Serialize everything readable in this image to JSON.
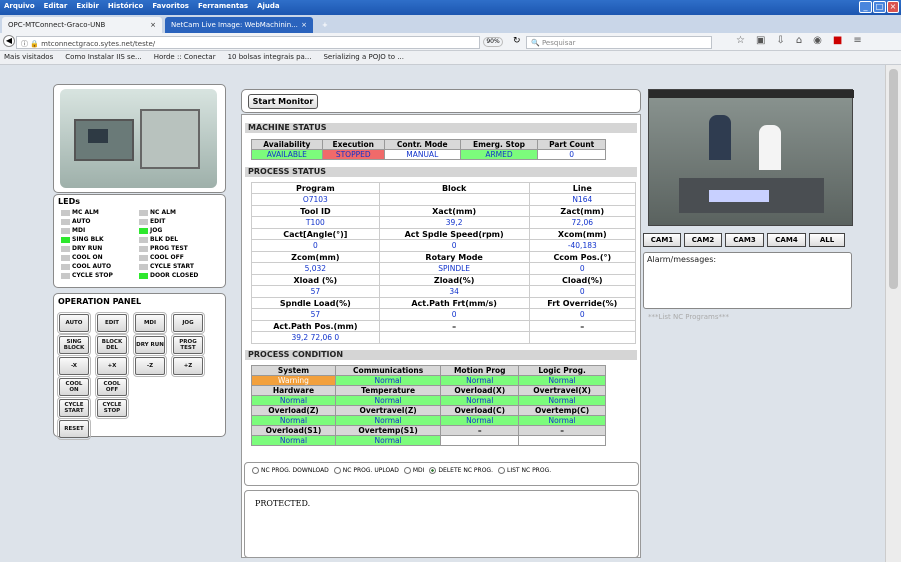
{
  "browser": {
    "menu": [
      "Arquivo",
      "Editar",
      "Exibir",
      "Histórico",
      "Favoritos",
      "Ferramentas",
      "Ajuda"
    ],
    "tabs": [
      "OPC-MTConnect-Graco-UNB",
      "NetCam Live Image: WebMachinin..."
    ],
    "new_tab": "+",
    "url": "mtconnectgraco.sytes.net/teste/",
    "zoom": "90%",
    "search_placeholder": "Pesquisar",
    "bookmarks": [
      "Mais visitados",
      "Como Instalar IIS se...",
      "Horde :: Conectar",
      "10 bolsas integrais pa...",
      "Serializing a POJO to ..."
    ]
  },
  "leds": {
    "title": "LEDs",
    "left": [
      {
        "label": "MC ALM",
        "on": false
      },
      {
        "label": "AUTO",
        "on": false
      },
      {
        "label": "MDI",
        "on": false
      },
      {
        "label": "SING BLK",
        "on": true
      },
      {
        "label": "DRY RUN",
        "on": false
      },
      {
        "label": "COOL ON",
        "on": false
      },
      {
        "label": "COOL AUTO",
        "on": false
      },
      {
        "label": "CYCLE STOP",
        "on": false
      }
    ],
    "right": [
      {
        "label": "NC ALM",
        "on": false
      },
      {
        "label": "EDIT",
        "on": false
      },
      {
        "label": "JOG",
        "on": true
      },
      {
        "label": "BLK DEL",
        "on": false
      },
      {
        "label": "PROG TEST",
        "on": false
      },
      {
        "label": "COOL OFF",
        "on": false
      },
      {
        "label": "CYCLE START",
        "on": false
      },
      {
        "label": "DOOR CLOSED",
        "on": true
      }
    ]
  },
  "operation_panel": {
    "title": "OPERATION PANEL",
    "buttons": [
      [
        "AUTO",
        "EDIT",
        "MDI",
        "JOG"
      ],
      [
        "SING BLOCK",
        "BLOCK DEL",
        "DRY RUN",
        "PROG TEST"
      ],
      [
        "-X",
        "+X",
        "-Z",
        "+Z"
      ],
      [
        "COOL ON",
        "COOL OFF"
      ],
      [
        "CYCLE START",
        "CYCLE STOP"
      ],
      [
        "RESET"
      ]
    ]
  },
  "start_monitor": "Start Monitor",
  "machine_status": {
    "title": "MACHINE STATUS",
    "headers": [
      "Availability",
      "Execution",
      "Contr. Mode",
      "Emerg. Stop",
      "Part Count"
    ],
    "values": [
      "AVAILABLE",
      "STOPPED",
      "MANUAL",
      "ARMED",
      "0"
    ]
  },
  "process_status": {
    "title": "PROCESS STATUS",
    "rows": [
      [
        "Program",
        "Block",
        "Line"
      ],
      [
        "O7103",
        "",
        "N164"
      ],
      [
        "Tool ID",
        "Xact(mm)",
        "Zact(mm)"
      ],
      [
        "T100",
        "39,2",
        "72,06"
      ],
      [
        "Cact[Angle(°)]",
        "Act Spdle Speed(rpm)",
        "Xcom(mm)"
      ],
      [
        "0",
        "0",
        "-40,183"
      ],
      [
        "Zcom(mm)",
        "Rotary Mode",
        "Ccom Pos.(°)"
      ],
      [
        "5,032",
        "SPINDLE",
        "0"
      ],
      [
        "Xload (%)",
        "Zload(%)",
        "Cload(%)"
      ],
      [
        "57",
        "34",
        "0"
      ],
      [
        "Spndle Load(%)",
        "Act.Path Frt(mm/s)",
        "Frt Override(%)"
      ],
      [
        "57",
        "0",
        "0"
      ],
      [
        "Act.Path Pos.(mm)",
        "–",
        "–"
      ],
      [
        "39,2 72,06 0",
        "",
        ""
      ]
    ]
  },
  "process_condition": {
    "title": "PROCESS CONDITION",
    "rows": [
      [
        "System",
        "Communications",
        "Motion Prog",
        "Logic Prog."
      ],
      [
        "Warning",
        "Normal",
        "Normal",
        "Normal"
      ],
      [
        "Hardware",
        "Temperature",
        "Overload(X)",
        "Overtravel(X)"
      ],
      [
        "Normal",
        "Normal",
        "Normal",
        "Normal"
      ],
      [
        "Overload(Z)",
        "Overtravel(Z)",
        "Overload(C)",
        "Overtemp(C)"
      ],
      [
        "Normal",
        "Normal",
        "Normal",
        "Normal"
      ],
      [
        "Overload(S1)",
        "Overtemp(S1)",
        "–",
        "–"
      ],
      [
        "Normal",
        "Normal",
        "",
        ""
      ]
    ]
  },
  "nc_options": [
    "NC PROG. DOWNLOAD",
    "NC PROG. UPLOAD",
    "MDI",
    "DELETE NC PROG.",
    "LIST NC PROG."
  ],
  "nc_selected": 3,
  "protected_text": "PROTECTED.",
  "cams": [
    "CAM1",
    "CAM2",
    "CAM3",
    "CAM4",
    "ALL"
  ],
  "alarm_label": "Alarm/messages:",
  "list_nc": "***List NC Programs***"
}
